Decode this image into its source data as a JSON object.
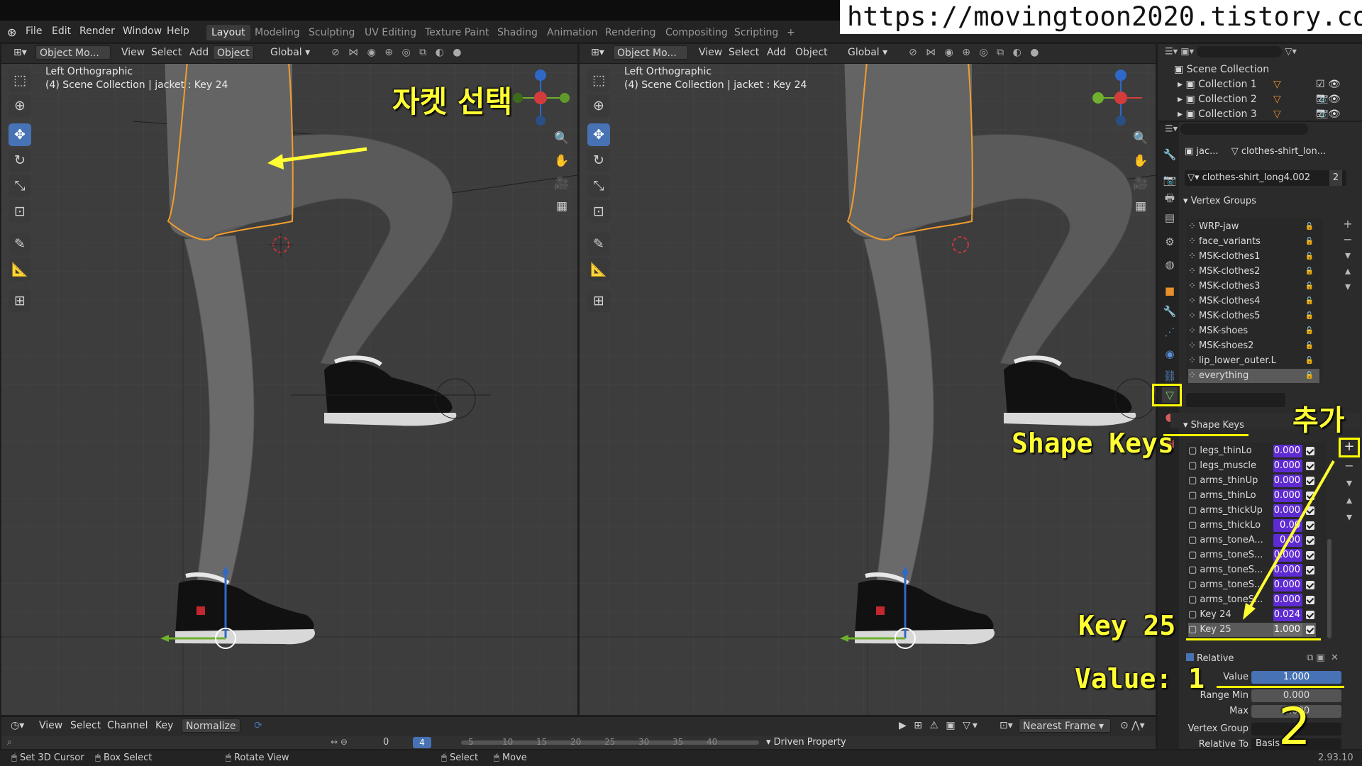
{
  "watermark": "https://movingtoon2020.tistory.com",
  "menu": [
    "File",
    "Edit",
    "Render",
    "Window",
    "Help"
  ],
  "workspaces": [
    "Layout",
    "Modeling",
    "Sculpting",
    "UV Editing",
    "Texture Paint",
    "Shading",
    "Animation",
    "Rendering",
    "Compositing",
    "Scripting",
    "+"
  ],
  "viewport": {
    "mode": "Object Mo...",
    "menus": [
      "View",
      "Select",
      "Add",
      "Object"
    ],
    "orientation": "Global",
    "view_name": "Left Orthographic",
    "collection_info": "(4) Scene Collection | jacket : Key 24"
  },
  "annotations": {
    "select_jacket": "자켓 선택",
    "add": "추가",
    "shape_keys": "Shape Keys",
    "key25": "Key 25",
    "value": "Value: 1",
    "step": "2"
  },
  "outliner": {
    "root": "Scene Collection",
    "items": [
      "Collection 1",
      "Collection 2",
      "Collection 3"
    ]
  },
  "properties": {
    "object_short": "jac...",
    "mesh_short": "clothes-shirt_lon...",
    "mesh_name": "clothes-shirt_long4.002",
    "users": "2",
    "vertex_groups_title": "Vertex Groups",
    "vertex_groups": [
      "WRP-jaw",
      "face_variants",
      "MSK-clothes1",
      "MSK-clothes2",
      "MSK-clothes3",
      "MSK-clothes4",
      "MSK-clothes5",
      "MSK-shoes",
      "MSK-shoes2",
      "lip_lower_outer.L",
      "everything"
    ],
    "shape_keys_title": "Shape Keys",
    "shape_keys": [
      {
        "name": "legs_thinLo",
        "value": "0.000"
      },
      {
        "name": "legs_muscle",
        "value": "0.000"
      },
      {
        "name": "arms_thinUp",
        "value": "0.000"
      },
      {
        "name": "arms_thinLo",
        "value": "0.000"
      },
      {
        "name": "arms_thickUp",
        "value": "0.000"
      },
      {
        "name": "arms_thickLo",
        "value": "0.00"
      },
      {
        "name": "arms_toneA...",
        "value": "0.00"
      },
      {
        "name": "arms_toneS...",
        "value": "0.000"
      },
      {
        "name": "arms_toneS...",
        "value": "0.000"
      },
      {
        "name": "arms_toneS...",
        "value": "0.000"
      },
      {
        "name": "arms_toneS...",
        "value": "0.000"
      },
      {
        "name": "Key 24",
        "value": "0.024"
      },
      {
        "name": "Key 25",
        "value": "1.000"
      }
    ],
    "relative_label": "Relative",
    "value_label": "Value",
    "value": "1.000",
    "range_min_label": "Range Min",
    "range_min": "0.000",
    "max_label": "Max",
    "max": "1.000",
    "vertex_group_label": "Vertex Group",
    "relative_to_label": "Relative To",
    "relative_to": "Basis"
  },
  "timeline": {
    "menus": [
      "View",
      "Select",
      "Channel",
      "Key"
    ],
    "normalize": "Normalize",
    "start_frame": "0",
    "current_frame": "4",
    "ticks": [
      "5",
      "10",
      "15",
      "20",
      "25",
      "30",
      "35",
      "40"
    ],
    "interp": "Nearest Frame",
    "driven": "Driven Property"
  },
  "status": {
    "items": [
      "Set 3D Cursor",
      "Box Select",
      "Rotate View",
      "Select",
      "Move"
    ],
    "version": "2.93.10"
  }
}
